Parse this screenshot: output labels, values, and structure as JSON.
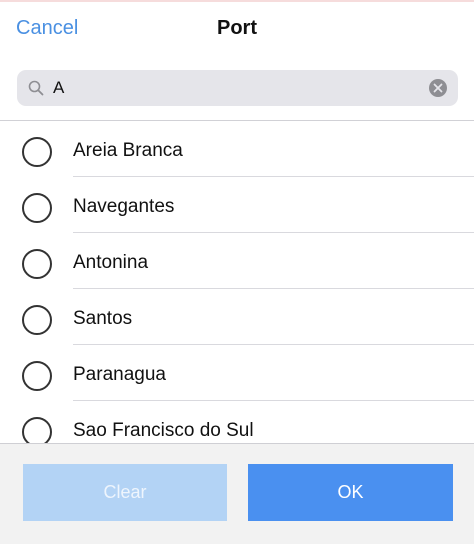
{
  "header": {
    "cancel_label": "Cancel",
    "title": "Port"
  },
  "search": {
    "value": "A",
    "icon": "search-icon",
    "clear_icon": "clear-circle-icon"
  },
  "ports": [
    {
      "label": "Areia Branca",
      "selected": false
    },
    {
      "label": "Navegantes",
      "selected": false
    },
    {
      "label": "Antonina",
      "selected": false
    },
    {
      "label": "Santos",
      "selected": false
    },
    {
      "label": "Paranagua",
      "selected": false
    },
    {
      "label": "Sao Francisco do Sul",
      "selected": false
    }
  ],
  "footer": {
    "clear_label": "Clear",
    "ok_label": "OK"
  },
  "colors": {
    "accent": "#4a90f0",
    "link": "#4a90e2",
    "clear_disabled": "#b3d3f5"
  }
}
